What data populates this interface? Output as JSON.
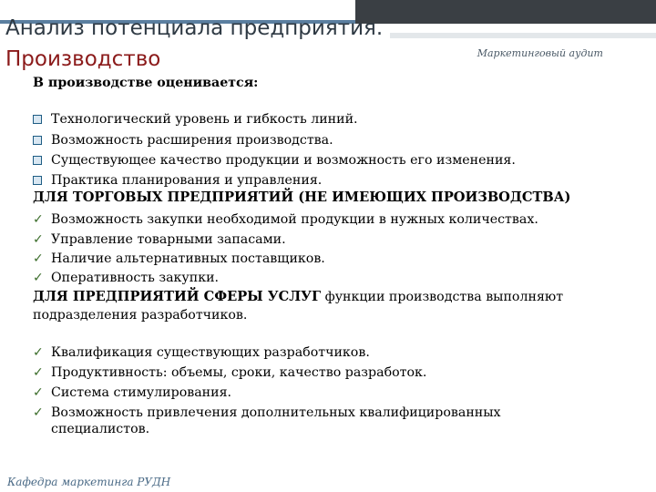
{
  "header": {
    "title_line1": "Анализ потенциала предприятия.",
    "title_line2": "Производство",
    "right_label": "Маркетинговый аудит"
  },
  "colors": {
    "title_accent": "#8b1a1a",
    "bar_dark": "#3a3f44",
    "check_green": "#3d6e2c",
    "square_blue": "#1f5d84"
  },
  "body": {
    "intro": "В производстве оценивается:",
    "production_items": [
      "Технологический уровень и гибкость линий.",
      "Возможность расширения производства.",
      "Существующее качество продукции и возможность его изменения.",
      "Практика планирования и управления."
    ],
    "trade_heading": "ДЛЯ ТОРГОВЫХ ПРЕДПРИЯТИЙ (НЕ ИМЕЮЩИХ ПРОИЗВОДСТВА)",
    "trade_items": [
      "Возможность закупки необходимой продукции в нужных количествах.",
      "Управление товарными запасами.",
      "Наличие альтернативных поставщиков.",
      "Оперативность закупки."
    ],
    "services_heading_bold": "ДЛЯ ПРЕДПРИЯТИЙ СФЕРЫ УСЛУГ",
    "services_heading_rest": " функции производства выполняют",
    "services_heading_line2": "подразделения разработчиков.",
    "services_items": [
      "Квалификация существующих разработчиков.",
      "Продуктивность: объемы, сроки, качество разработок.",
      "Система стимулирования.",
      "Возможность привлечения дополнительных квалифицированных"
    ],
    "services_last_item_cont": "специалистов."
  },
  "footer": {
    "text": "Кафедра маркетинга РУДН"
  }
}
